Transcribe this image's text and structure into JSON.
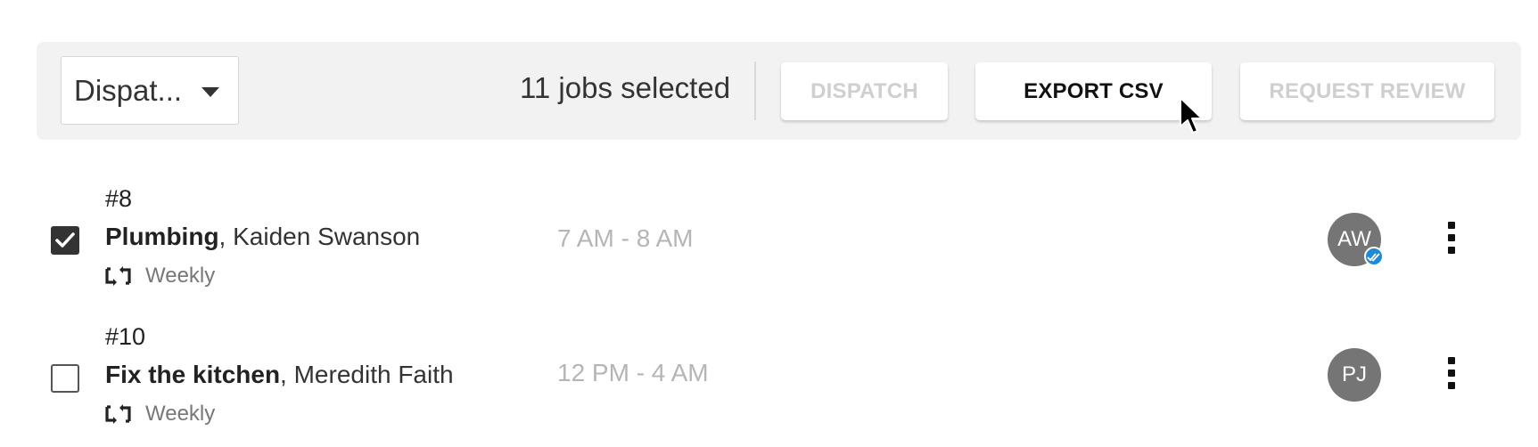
{
  "toolbar": {
    "view_select": {
      "value": "Dispat...",
      "icon": "caret-down-icon"
    },
    "selection_status": "11 jobs selected",
    "buttons": {
      "dispatch": {
        "label": "DISPATCH",
        "enabled": false
      },
      "export_csv": {
        "label": "EXPORT CSV",
        "enabled": true
      },
      "request_review": {
        "label": "REQUEST REVIEW",
        "enabled": false
      }
    }
  },
  "jobs": [
    {
      "number": "#8",
      "title": "Plumbing",
      "customer": ", Kaiden Swanson",
      "recurrence": "Weekly",
      "time": "7 AM - 8 AM",
      "assignee_initials": "AW",
      "assignee_verified": true,
      "checked": true
    },
    {
      "number": "#10",
      "title": "Fix the kitchen",
      "customer": ", Meredith Faith",
      "recurrence": "Weekly",
      "time": "12 PM - 4 AM",
      "assignee_initials": "PJ",
      "assignee_verified": false,
      "checked": false
    }
  ],
  "colors": {
    "toolbar_bg": "#f2f2f2",
    "avatar_bg": "#757575",
    "verified_badge": "#1e8ad6",
    "disabled_text": "#cfcfcf",
    "time_text": "#b5b5b5"
  }
}
